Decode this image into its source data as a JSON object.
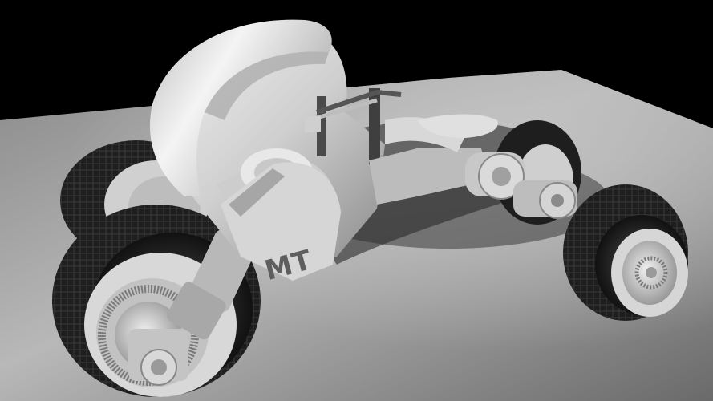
{
  "scene": {
    "subject": "render-of-motorcycle-concept",
    "emblem_text": "MT",
    "colors": {
      "background": "#000000",
      "floor_light": "#b4b4b4",
      "floor_dark": "#5a5a5a",
      "body": "#d2d2d2",
      "tire": "#1c1c1c",
      "rim": "#cfcfcf"
    }
  }
}
